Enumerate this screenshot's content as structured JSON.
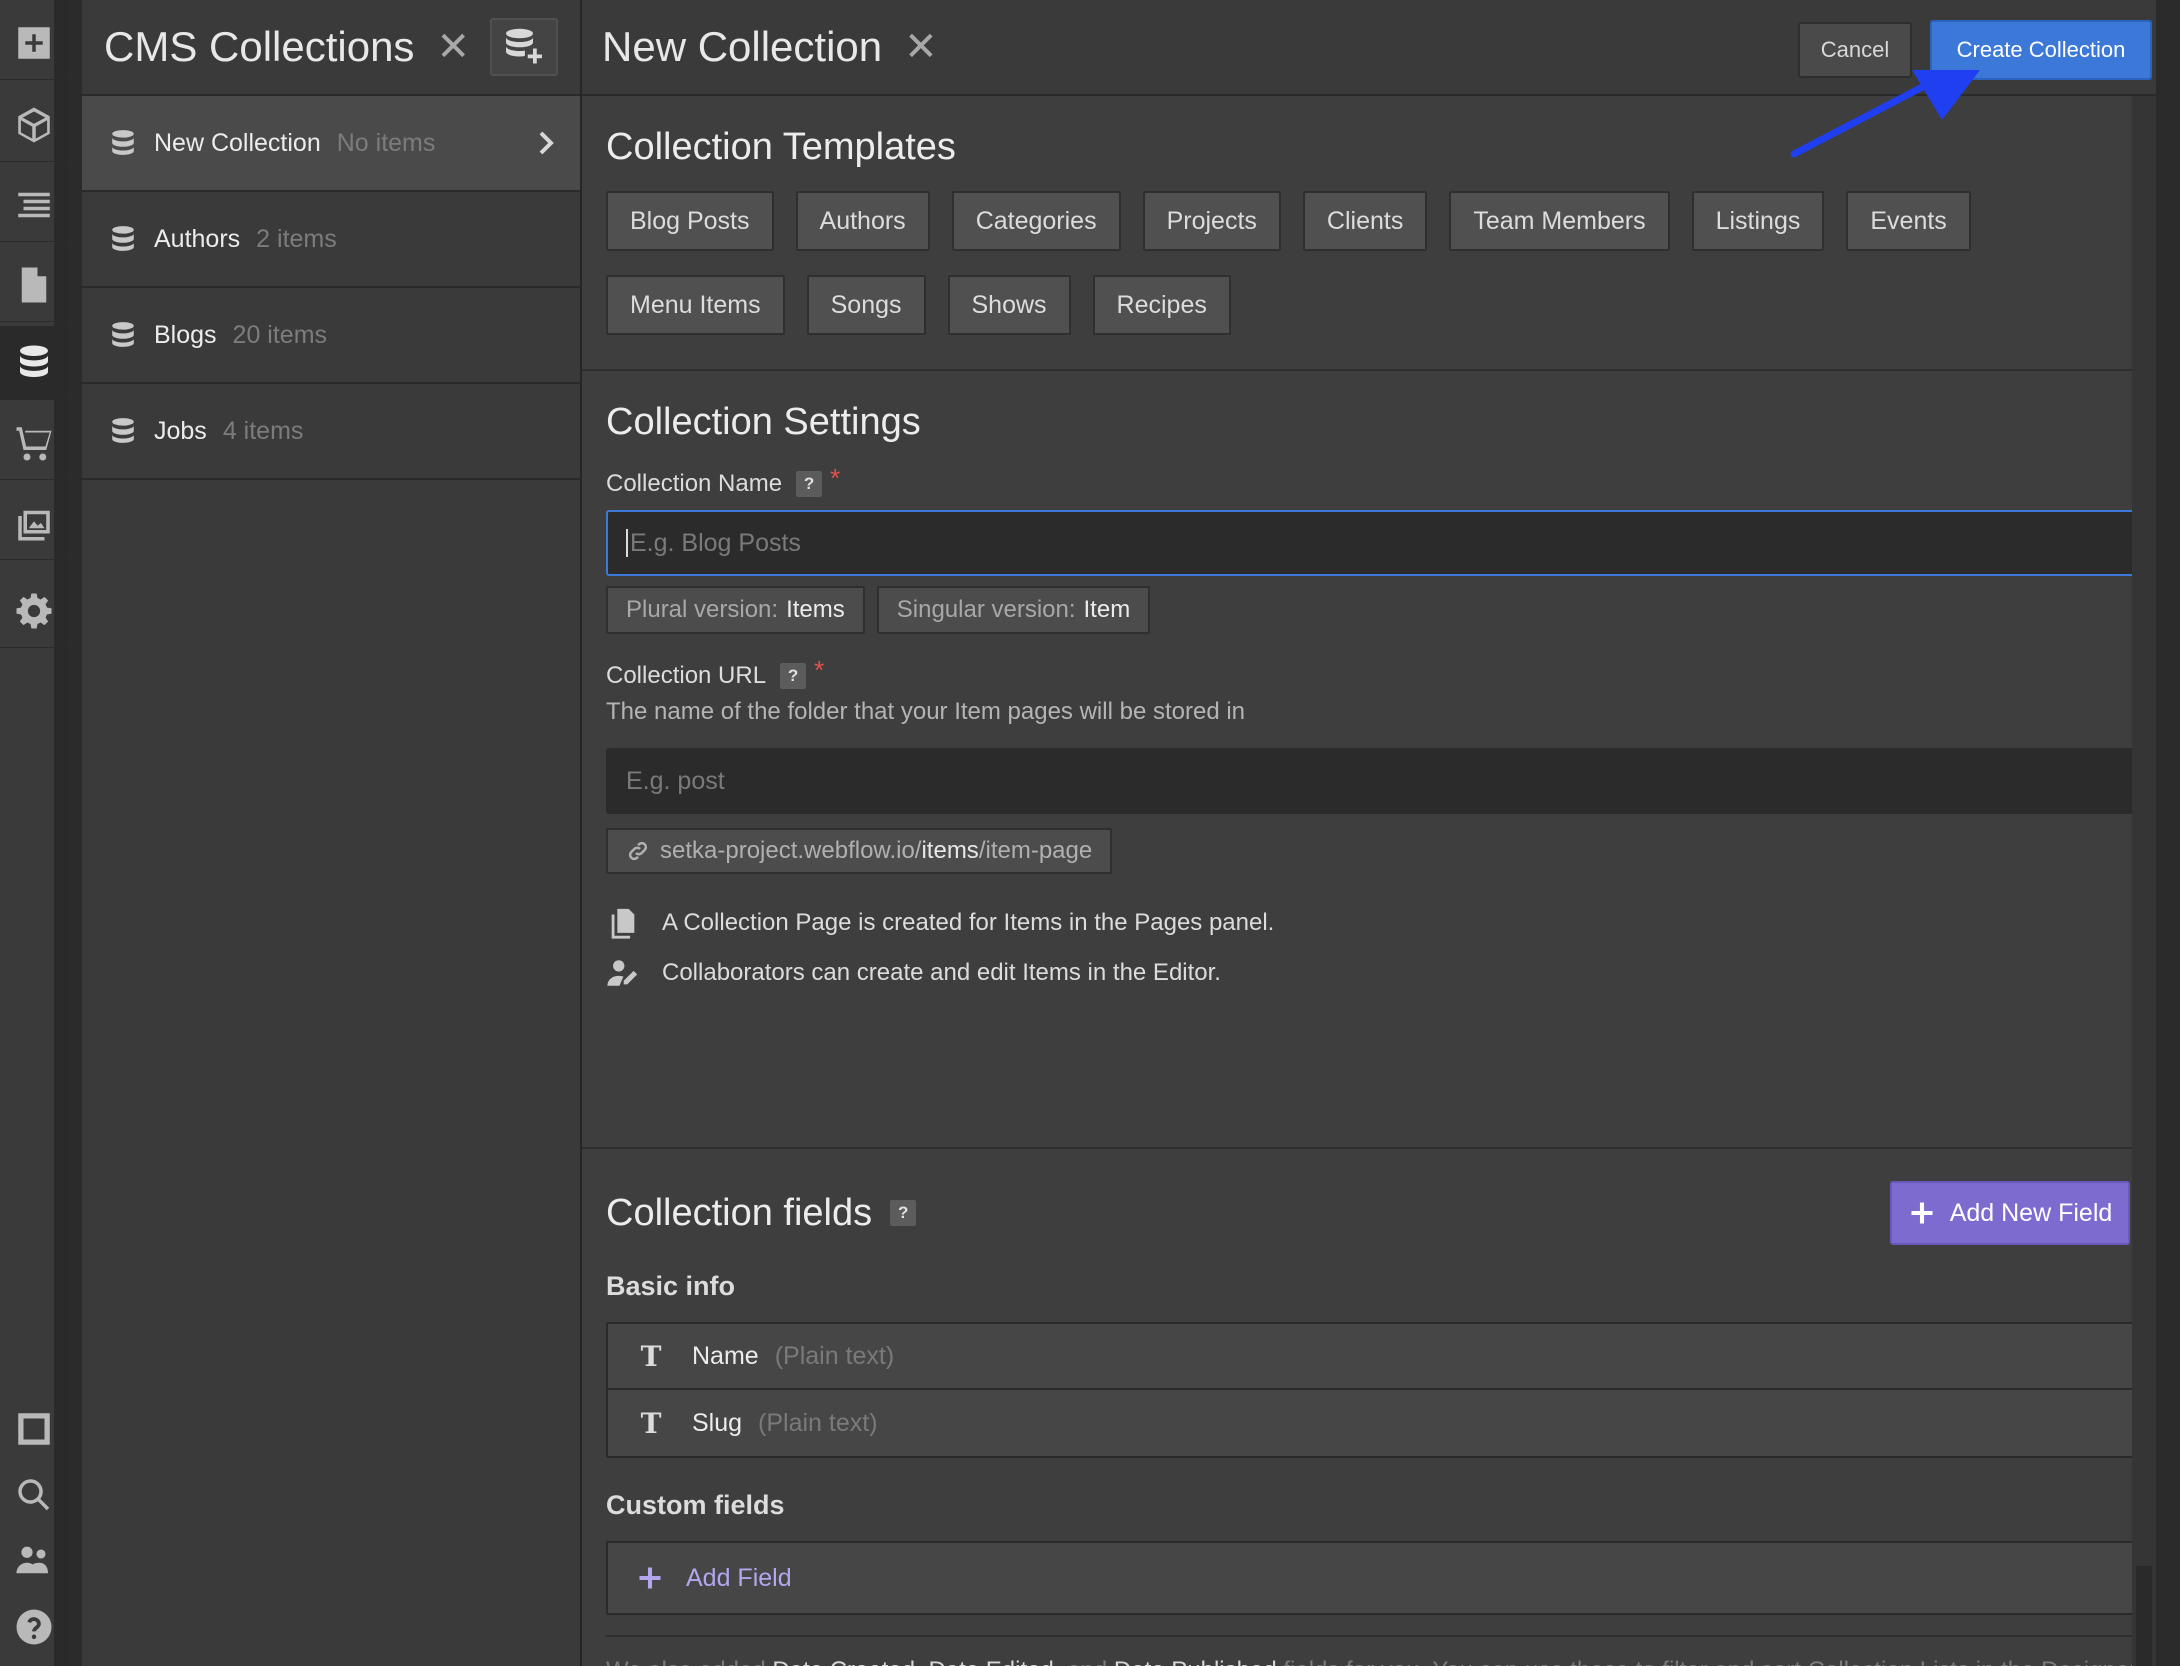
{
  "rail": {
    "icons": [
      "add-icon",
      "cube-icon",
      "navigator-icon",
      "pages-icon",
      "cms-icon",
      "ecommerce-icon",
      "assets-icon",
      "settings-icon",
      "square-icon",
      "search-icon",
      "users-icon",
      "help-icon"
    ]
  },
  "cms": {
    "title": "CMS Collections",
    "items": [
      {
        "name": "New Collection",
        "count": "No items"
      },
      {
        "name": "Authors",
        "count": "2 items"
      },
      {
        "name": "Blogs",
        "count": "20 items"
      },
      {
        "name": "Jobs",
        "count": "4 items"
      }
    ]
  },
  "main": {
    "title": "New Collection",
    "cancel_label": "Cancel",
    "create_label": "Create Collection"
  },
  "templates": {
    "title": "Collection Templates",
    "items": [
      "Blog Posts",
      "Authors",
      "Categories",
      "Projects",
      "Clients",
      "Team Members",
      "Listings",
      "Events",
      "Menu Items",
      "Songs",
      "Shows",
      "Recipes"
    ]
  },
  "settings": {
    "title": "Collection Settings",
    "name_label": "Collection Name",
    "name_placeholder": "E.g. Blog Posts",
    "plural_label": "Plural version:",
    "plural_value": "Items",
    "singular_label": "Singular version:",
    "singular_value": "Item",
    "url_label": "Collection URL",
    "url_hint": "The name of the folder that your Item pages will be stored in",
    "url_placeholder": "E.g. post",
    "url_prefix": "setka-project.webflow.io/",
    "url_highlight": "items",
    "url_suffix": "/item-page",
    "info_pages": "A Collection Page is created for Items in the Pages panel.",
    "info_editor": "Collaborators can create and edit Items in the Editor."
  },
  "fields": {
    "title": "Collection fields",
    "add_new_label": "Add New Field",
    "basic_title": "Basic info",
    "basic": [
      {
        "name": "Name",
        "type": "(Plain text)"
      },
      {
        "name": "Slug",
        "type": "(Plain text)"
      }
    ],
    "custom_title": "Custom fields",
    "add_field_label": "Add Field",
    "note": {
      "p1": "We also added ",
      "d1": "Date Created",
      "p2": ", ",
      "d2": "Date Edited",
      "p3": ", and ",
      "d3": "Date Published",
      "p4": " fields for you. You can use these to filter and sort Collection Lists in the Designer. These don’t count against your field limit."
    }
  },
  "colors": {
    "accent_blue": "#3b78d8",
    "accent_purple": "#7e6bd0",
    "required": "#e5504a",
    "annotation_arrow": "#1f3ff0"
  }
}
